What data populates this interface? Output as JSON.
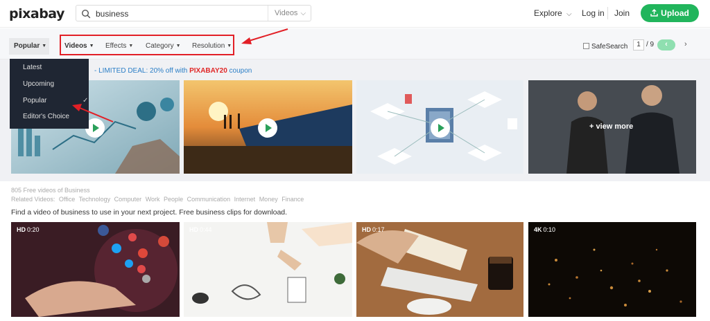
{
  "header": {
    "logo": "pixabay",
    "search": {
      "query": "business",
      "type": "Videos"
    },
    "nav": {
      "explore": "Explore",
      "login": "Log in",
      "join": "Join"
    },
    "upload_label": "Upload"
  },
  "filters": {
    "popular": "Popular",
    "videos": "Videos",
    "effects": "Effects",
    "category": "Category",
    "resolution": "Resolution",
    "safesearch": "SafeSearch",
    "page_current": "1",
    "page_total": "/ 9",
    "prev": "‹",
    "next": "›"
  },
  "dropdown": {
    "items": [
      "Latest",
      "Upcoming",
      "Popular",
      "Editor's Choice"
    ],
    "checkmark": "✓"
  },
  "promo": {
    "text": "- LIMITED DEAL: 20% off with ",
    "code": "PIXABAY20",
    "suffix": " coupon"
  },
  "featured": {
    "view_more": "+ view more"
  },
  "results": {
    "count": "805 Free videos of Business",
    "related_label": "Related Videos:",
    "related": [
      "Office",
      "Technology",
      "Computer",
      "Work",
      "People",
      "Communication",
      "Internet",
      "Money",
      "Finance"
    ],
    "description": "Find a video of business to use in your next project. Free business clips for download."
  },
  "videos": [
    {
      "quality": "HD",
      "duration": "0:20"
    },
    {
      "quality": "HD",
      "duration": "0:44"
    },
    {
      "quality": "HD",
      "duration": "0:17"
    },
    {
      "quality": "4K",
      "duration": "0:10"
    }
  ],
  "colors": {
    "accent": "#21b55c",
    "annotation": "#e21f26",
    "promo_link": "#2a7ec6",
    "dropdown_bg": "#1f2633"
  }
}
